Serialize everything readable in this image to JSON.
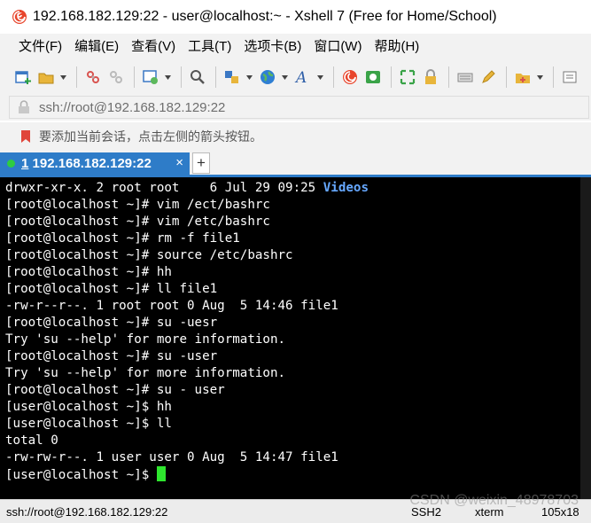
{
  "window": {
    "title": "192.168.182.129:22 - user@localhost:~ - Xshell 7 (Free for Home/School)",
    "app_icon": "xshell-icon"
  },
  "menu": [
    "文件(F)",
    "编辑(E)",
    "查看(V)",
    "工具(T)",
    "选项卡(B)",
    "窗口(W)",
    "帮助(H)"
  ],
  "toolbar": {
    "icons": [
      "new-session-icon",
      "open-folder-icon",
      "reconnect-icon",
      "disconnect-icon",
      "properties-icon",
      "find-icon",
      "transfer-icon",
      "globe-icon",
      "font-icon",
      "xshell-icon",
      "xftp-icon",
      "fullscreen-icon",
      "lock-icon",
      "keyboard-icon",
      "compose-icon",
      "add-folder-icon"
    ]
  },
  "address": {
    "value": "ssh://root@192.168.182.129:22"
  },
  "hint": {
    "text": "要添加当前会话，点击左侧的箭头按钮。"
  },
  "tabs": [
    {
      "index": "1",
      "label": "192.168.182.129:22",
      "close": "×",
      "active": true
    }
  ],
  "add_tab": "+",
  "terminal": {
    "colors": {
      "background": "#000000",
      "text": "#ffffff",
      "directory": "#66a8ff",
      "cursor": "#2ee62e"
    },
    "lines": [
      {
        "text": "drwxr-xr-x. 2 root root    6 Jul 29 09:25 ",
        "highlight": "Videos"
      },
      {
        "text": "[root@localhost ~]# vim /ect/bashrc"
      },
      {
        "text": "[root@localhost ~]# vim /etc/bashrc"
      },
      {
        "text": "[root@localhost ~]# rm -f file1"
      },
      {
        "text": "[root@localhost ~]# source /etc/bashrc"
      },
      {
        "text": "[root@localhost ~]# hh"
      },
      {
        "text": "[root@localhost ~]# ll file1"
      },
      {
        "text": "-rw-r--r--. 1 root root 0 Aug  5 14:46 file1"
      },
      {
        "text": "[root@localhost ~]# su -uesr"
      },
      {
        "text": "Try 'su --help' for more information."
      },
      {
        "text": "[root@localhost ~]# su -user"
      },
      {
        "text": "Try 'su --help' for more information."
      },
      {
        "text": "[root@localhost ~]# su - user"
      },
      {
        "text": "[user@localhost ~]$ hh"
      },
      {
        "text": "[user@localhost ~]$ ll"
      },
      {
        "text": "total 0"
      },
      {
        "text": "-rw-rw-r--. 1 user user 0 Aug  5 14:47 file1"
      }
    ],
    "prompt": "[user@localhost ~]$ "
  },
  "status": {
    "connection": "ssh://root@192.168.182.129:22",
    "protocol": "SSH2",
    "terminal_type": "xterm",
    "size": "105x18"
  },
  "watermark": "CSDN @weixin_48978703"
}
